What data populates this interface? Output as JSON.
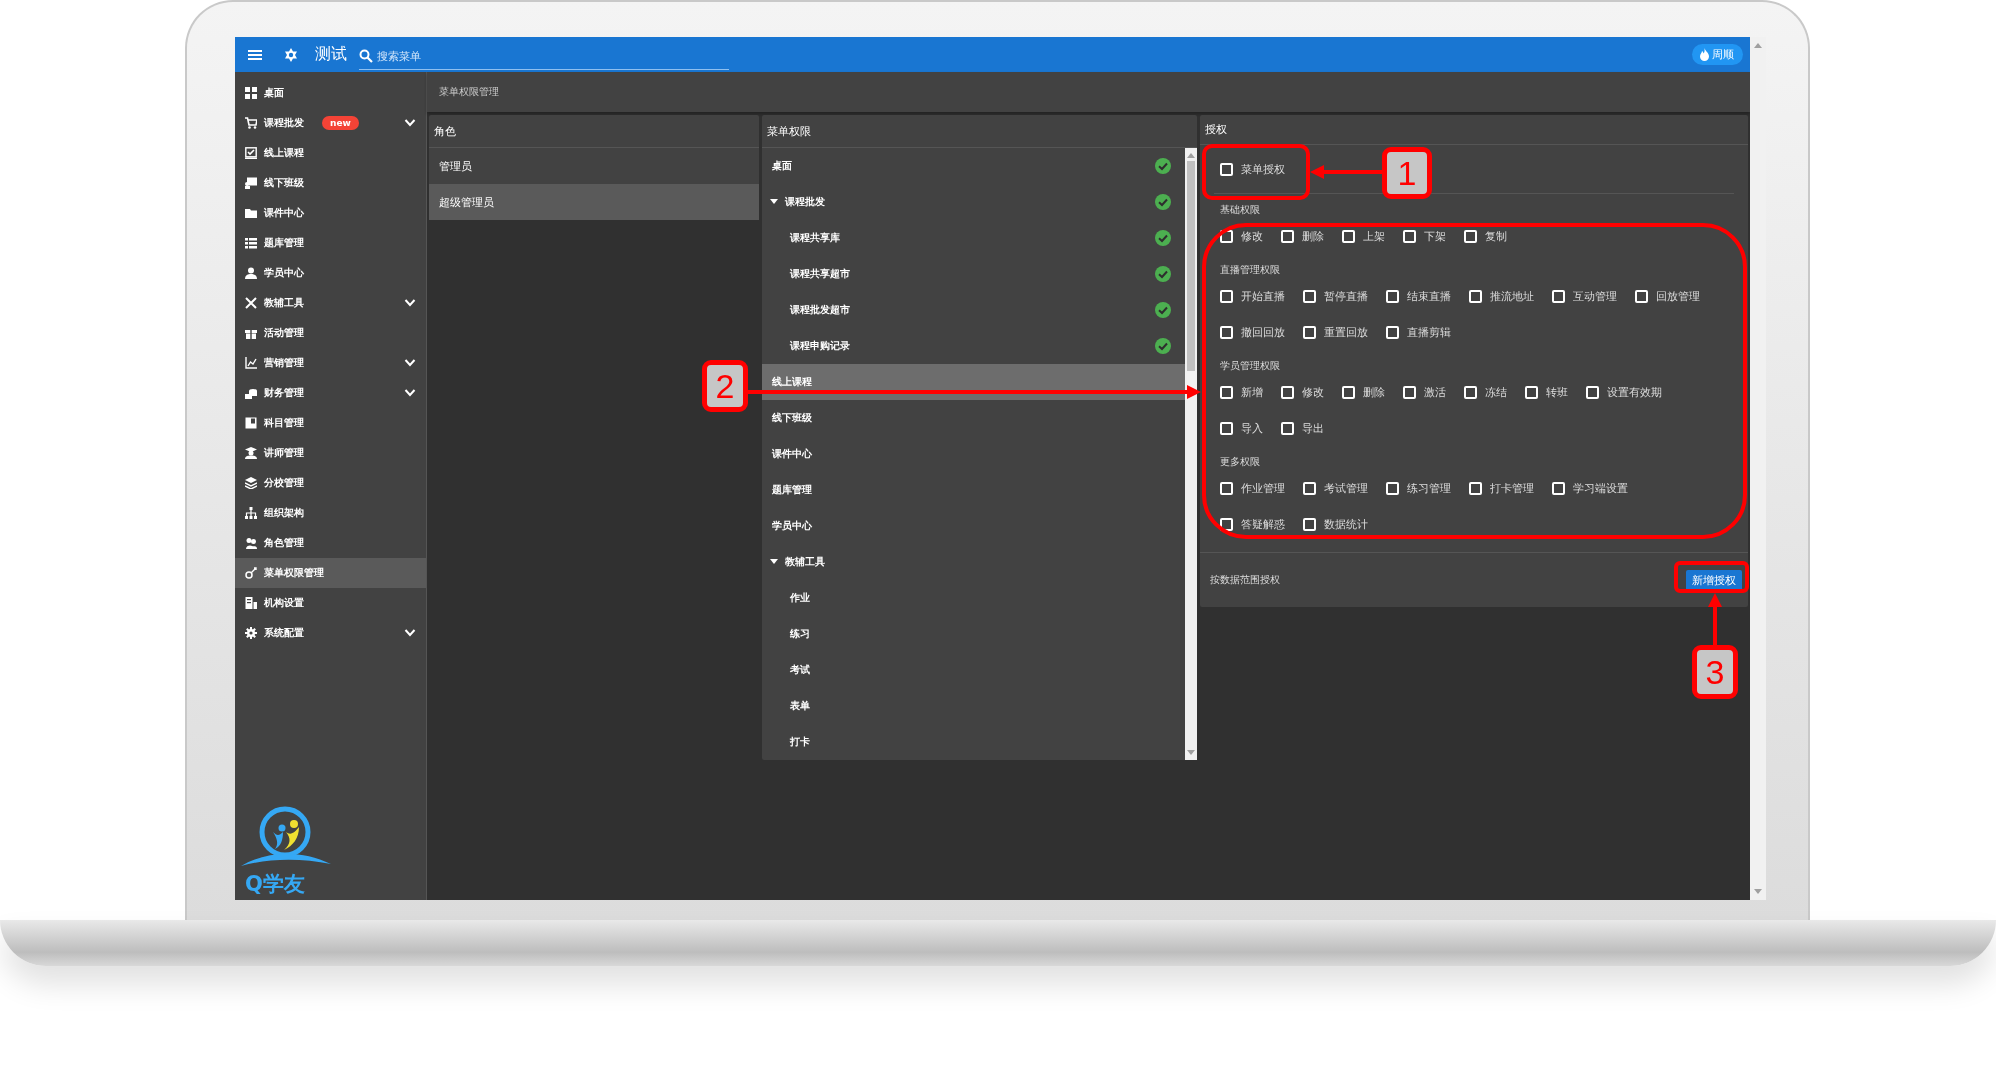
{
  "top_bar": {
    "title": "测试",
    "search": {
      "placeholder": "搜索菜单"
    },
    "user": "周顺"
  },
  "sidebar": {
    "items": [
      {
        "label": "桌面",
        "selected": false,
        "expandable": false
      },
      {
        "label": "课程批发",
        "badge": "new",
        "selected": false,
        "expandable": true
      },
      {
        "label": "线上课程",
        "selected": false,
        "expandable": false
      },
      {
        "label": "线下班级",
        "selected": false,
        "expandable": false
      },
      {
        "label": "课件中心",
        "selected": false,
        "expandable": false
      },
      {
        "label": "题库管理",
        "selected": false,
        "expandable": false
      },
      {
        "label": "学员中心",
        "selected": false,
        "expandable": false
      },
      {
        "label": "教辅工具",
        "selected": false,
        "expandable": true
      },
      {
        "label": "活动管理",
        "selected": false,
        "expandable": false
      },
      {
        "label": "营销管理",
        "selected": false,
        "expandable": true
      },
      {
        "label": "财务管理",
        "selected": false,
        "expandable": true
      },
      {
        "label": "科目管理",
        "selected": false,
        "expandable": false
      },
      {
        "label": "讲师管理",
        "selected": false,
        "expandable": false
      },
      {
        "label": "分校管理",
        "selected": false,
        "expandable": false
      },
      {
        "label": "组织架构",
        "selected": false,
        "expandable": false
      },
      {
        "label": "角色管理",
        "selected": false,
        "expandable": false
      },
      {
        "label": "菜单权限管理",
        "selected": true,
        "expandable": false
      },
      {
        "label": "机构设置",
        "selected": false,
        "expandable": false
      },
      {
        "label": "系统配置",
        "selected": false,
        "expandable": true
      }
    ],
    "brand": "Q学友"
  },
  "breadcrumb": "菜单权限管理",
  "roles": {
    "title": "角色",
    "items": [
      {
        "label": "管理员",
        "selected": false
      },
      {
        "label": "超级管理员",
        "selected": true
      }
    ]
  },
  "menu_permissions": {
    "title": "菜单权限",
    "items": [
      {
        "label": "桌面",
        "checked": true,
        "selected": false
      },
      {
        "label": "课程批发",
        "checked": true,
        "selected": false,
        "expanded": true,
        "children": [
          {
            "label": "课程共享库",
            "checked": true,
            "selected": false
          },
          {
            "label": "课程共享超市",
            "checked": true,
            "selected": false
          },
          {
            "label": "课程批发超市",
            "checked": true,
            "selected": false
          },
          {
            "label": "课程申购记录",
            "checked": true,
            "selected": false
          }
        ]
      },
      {
        "label": "线上课程",
        "checked": false,
        "selected": true
      },
      {
        "label": "线下班级",
        "checked": false,
        "selected": false
      },
      {
        "label": "课件中心",
        "checked": false,
        "selected": false
      },
      {
        "label": "题库管理",
        "checked": false,
        "selected": false
      },
      {
        "label": "学员中心",
        "checked": false,
        "selected": false
      },
      {
        "label": "教辅工具",
        "checked": false,
        "selected": false,
        "expanded": true,
        "children": [
          {
            "label": "作业",
            "checked": false,
            "selected": false
          },
          {
            "label": "练习",
            "checked": false,
            "selected": false
          },
          {
            "label": "考试",
            "checked": false,
            "selected": false
          },
          {
            "label": "表单",
            "checked": false,
            "selected": false
          },
          {
            "label": "打卡",
            "checked": false,
            "selected": false
          }
        ]
      }
    ]
  },
  "authorization": {
    "title": "授权",
    "menu_auth": {
      "label": "菜单授权",
      "checked": false
    },
    "groups": [
      {
        "title": "基础权限",
        "rows": [
          [
            {
              "label": "修改",
              "checked": false
            },
            {
              "label": "删除",
              "checked": false
            },
            {
              "label": "上架",
              "checked": false
            },
            {
              "label": "下架",
              "checked": false
            },
            {
              "label": "复制",
              "checked": false
            }
          ]
        ]
      },
      {
        "title": "直播管理权限",
        "rows": [
          [
            {
              "label": "开始直播",
              "checked": false
            },
            {
              "label": "暂停直播",
              "checked": false
            },
            {
              "label": "结束直播",
              "checked": false
            },
            {
              "label": "推流地址",
              "checked": false
            },
            {
              "label": "互动管理",
              "checked": false
            },
            {
              "label": "回放管理",
              "checked": false
            }
          ],
          [
            {
              "label": "撤回回放",
              "checked": false
            },
            {
              "label": "重置回放",
              "checked": false
            },
            {
              "label": "直播剪辑",
              "checked": false
            }
          ]
        ]
      },
      {
        "title": "学员管理权限",
        "rows": [
          [
            {
              "label": "新增",
              "checked": false
            },
            {
              "label": "修改",
              "checked": false
            },
            {
              "label": "删除",
              "checked": false
            },
            {
              "label": "激活",
              "checked": false
            },
            {
              "label": "冻结",
              "checked": false
            },
            {
              "label": "转班",
              "checked": false
            },
            {
              "label": "设置有效期",
              "checked": false
            }
          ],
          [
            {
              "label": "导入",
              "checked": false
            },
            {
              "label": "导出",
              "checked": false
            }
          ]
        ]
      },
      {
        "title": "更多权限",
        "rows": [
          [
            {
              "label": "作业管理",
              "checked": false
            },
            {
              "label": "考试管理",
              "checked": false
            },
            {
              "label": "练习管理",
              "checked": false
            },
            {
              "label": "打卡管理",
              "checked": false
            },
            {
              "label": "学习端设置",
              "checked": false
            }
          ],
          [
            {
              "label": "答疑解惑",
              "checked": false
            },
            {
              "label": "数据统计",
              "checked": false
            }
          ]
        ]
      }
    ],
    "data_scope": {
      "label": "按数据范围授权",
      "button": "新增授权"
    }
  },
  "callouts": [
    {
      "label": "1"
    },
    {
      "label": "2"
    },
    {
      "label": "3"
    }
  ]
}
